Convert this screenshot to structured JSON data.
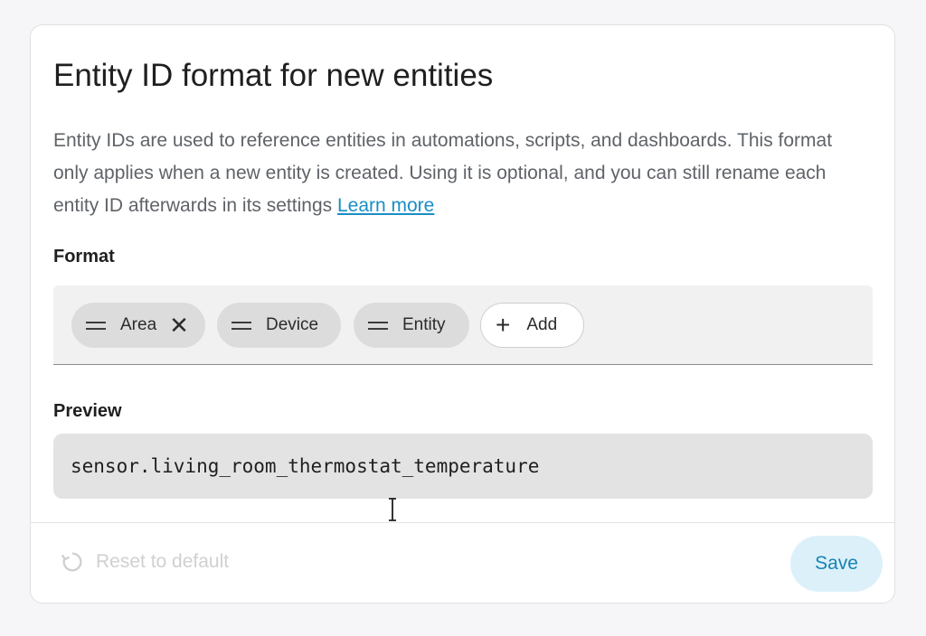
{
  "dialog": {
    "title": "Entity ID format for new entities",
    "description": "Entity IDs are used to reference entities in automations, scripts, and dashboards. This format only applies when a new entity is created. Using it is optional, and you can still rename each entity ID afterwards in its settings",
    "learn_more": "Learn more"
  },
  "format": {
    "label": "Format",
    "chips": [
      {
        "label": "Area",
        "removable": true
      },
      {
        "label": "Device",
        "removable": false
      },
      {
        "label": "Entity",
        "removable": false
      }
    ],
    "add_label": "Add"
  },
  "preview": {
    "label": "Preview",
    "value": "sensor.living_room_thermostat_temperature"
  },
  "footer": {
    "reset_label": "Reset to default",
    "save_label": "Save"
  },
  "colors": {
    "accent": "#1583b4",
    "link": "#1a8ec6",
    "save_bg": "#dcf0fa",
    "chip_bg": "#dcdcdc"
  }
}
